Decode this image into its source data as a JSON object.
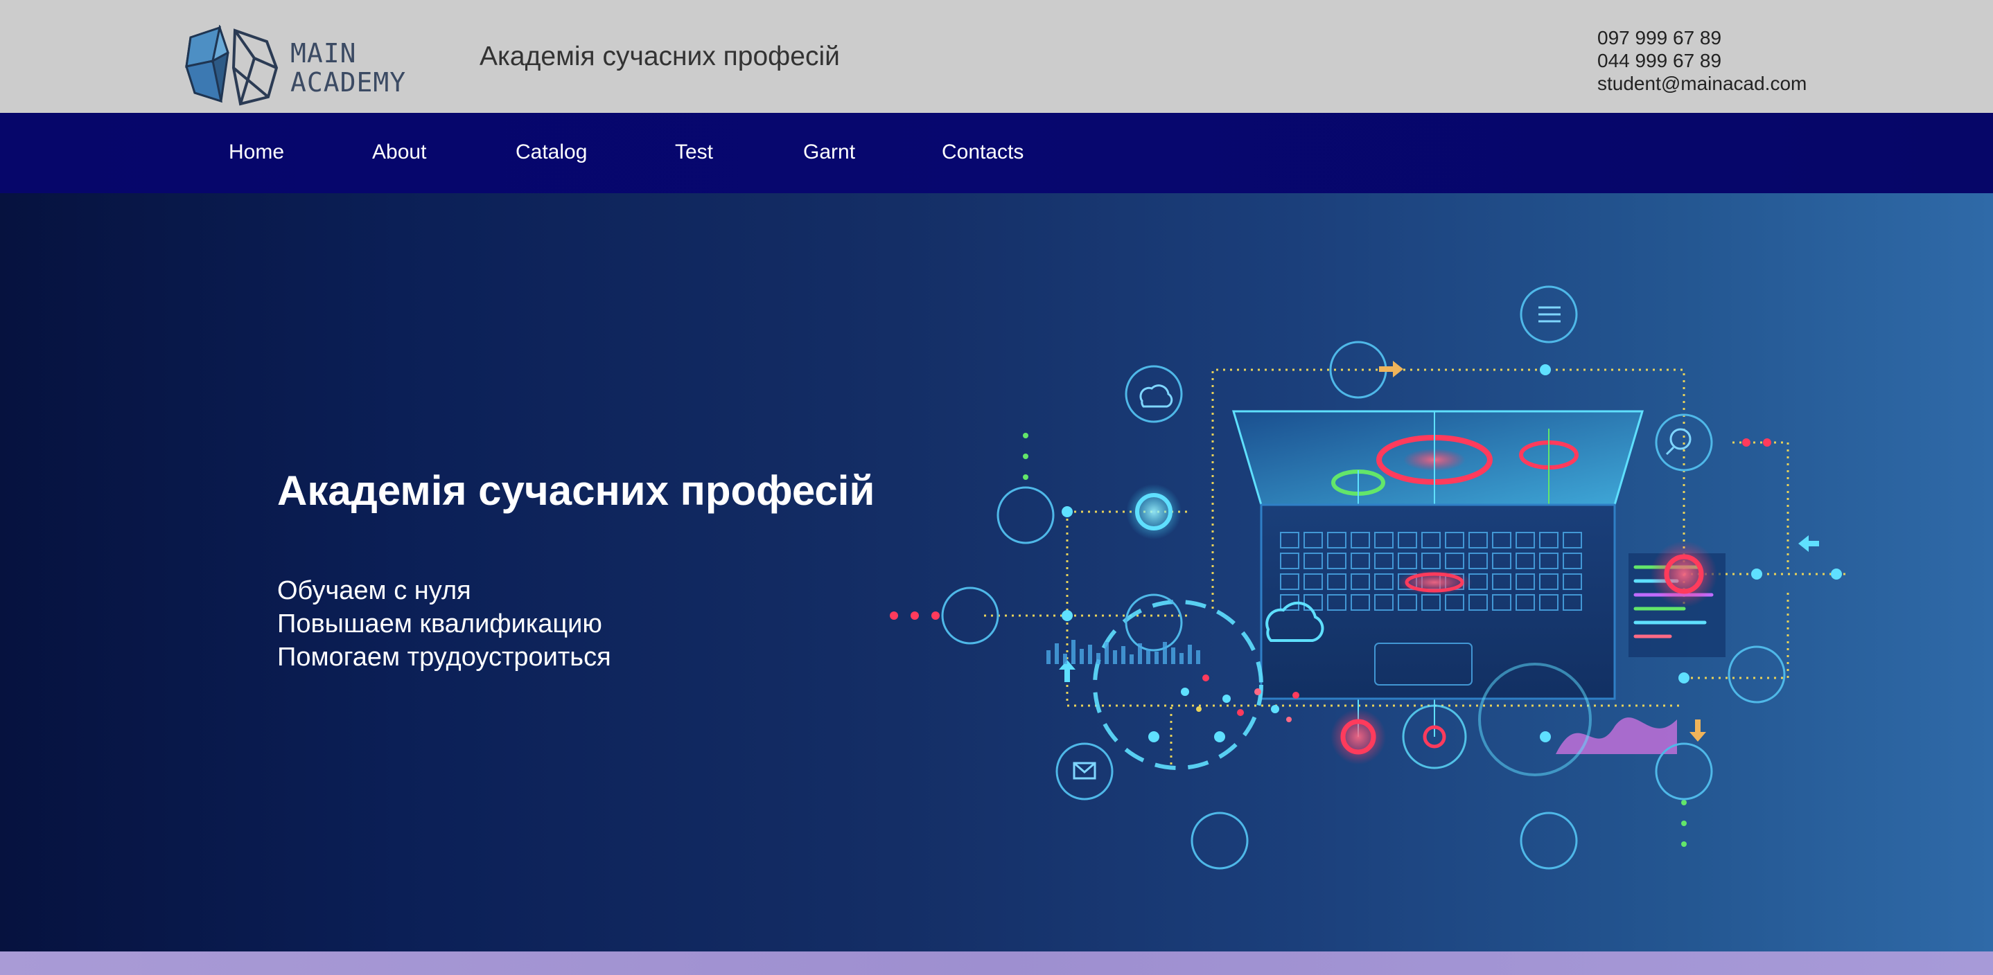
{
  "header": {
    "logo": {
      "line1": "MAIN",
      "line2": "ACADEMY"
    },
    "title": "Академія сучасних професій",
    "contacts": {
      "phone1": "097 999 67 89",
      "phone2": "044 999 67 89",
      "email": "student@mainacad.com"
    }
  },
  "nav": {
    "items": [
      {
        "label": "Home"
      },
      {
        "label": "About"
      },
      {
        "label": "Catalog"
      },
      {
        "label": "Test"
      },
      {
        "label": "Garnt"
      },
      {
        "label": "Contacts"
      }
    ]
  },
  "hero": {
    "title": "Академія сучасних професій",
    "lines": [
      "Обучаем с нуля",
      "Повышаем квалификацию",
      "Помогаем трудоустроиться"
    ],
    "illustration": "laptop-network-illustration"
  },
  "colors": {
    "header_bg": "#cccccc",
    "nav_bg": "#07076f",
    "hero_dark": "#06123f",
    "hero_light": "#2f6aa8",
    "accent_cyan": "#5fe0ff",
    "accent_red": "#ff3b5c",
    "accent_yellow": "#e8d25a",
    "bottom_stripe": "#a99bd6"
  }
}
